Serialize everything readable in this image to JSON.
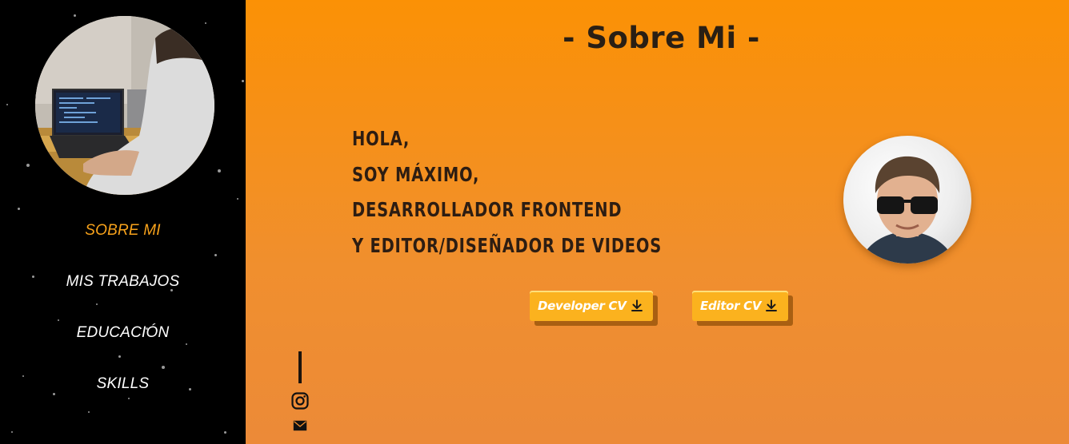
{
  "sidebar": {
    "nav": [
      {
        "label": "SOBRE MI",
        "active": true
      },
      {
        "label": "MIS TRABAJOS",
        "active": false
      },
      {
        "label": "EDUCACIÓN",
        "active": false
      },
      {
        "label": "SKILLS",
        "active": false
      }
    ],
    "profile_photo": "person-at-laptop-photo"
  },
  "main": {
    "title": "- Sobre Mi -",
    "intro_lines": [
      "HOLA,",
      "SOY MÁXIMO,",
      "DESARROLLADOR FRONTEND",
      "Y EDITOR/DISEÑADOR DE VIDEOS"
    ],
    "avatar": "portrait-with-sunglasses",
    "buttons": [
      {
        "label": "Developer CV",
        "icon": "download-icon"
      },
      {
        "label": "Editor CV",
        "icon": "download-icon"
      }
    ],
    "social_icons": [
      "instagram-icon",
      "mail-icon"
    ]
  },
  "colors": {
    "accent": "#f7a21b",
    "main_bg_top": "#fb9105",
    "main_bg_bottom": "#ec8a38",
    "button_bg": "#fbb21e",
    "button_shadow": "#a95f12",
    "text_dark": "#2d1d12"
  }
}
